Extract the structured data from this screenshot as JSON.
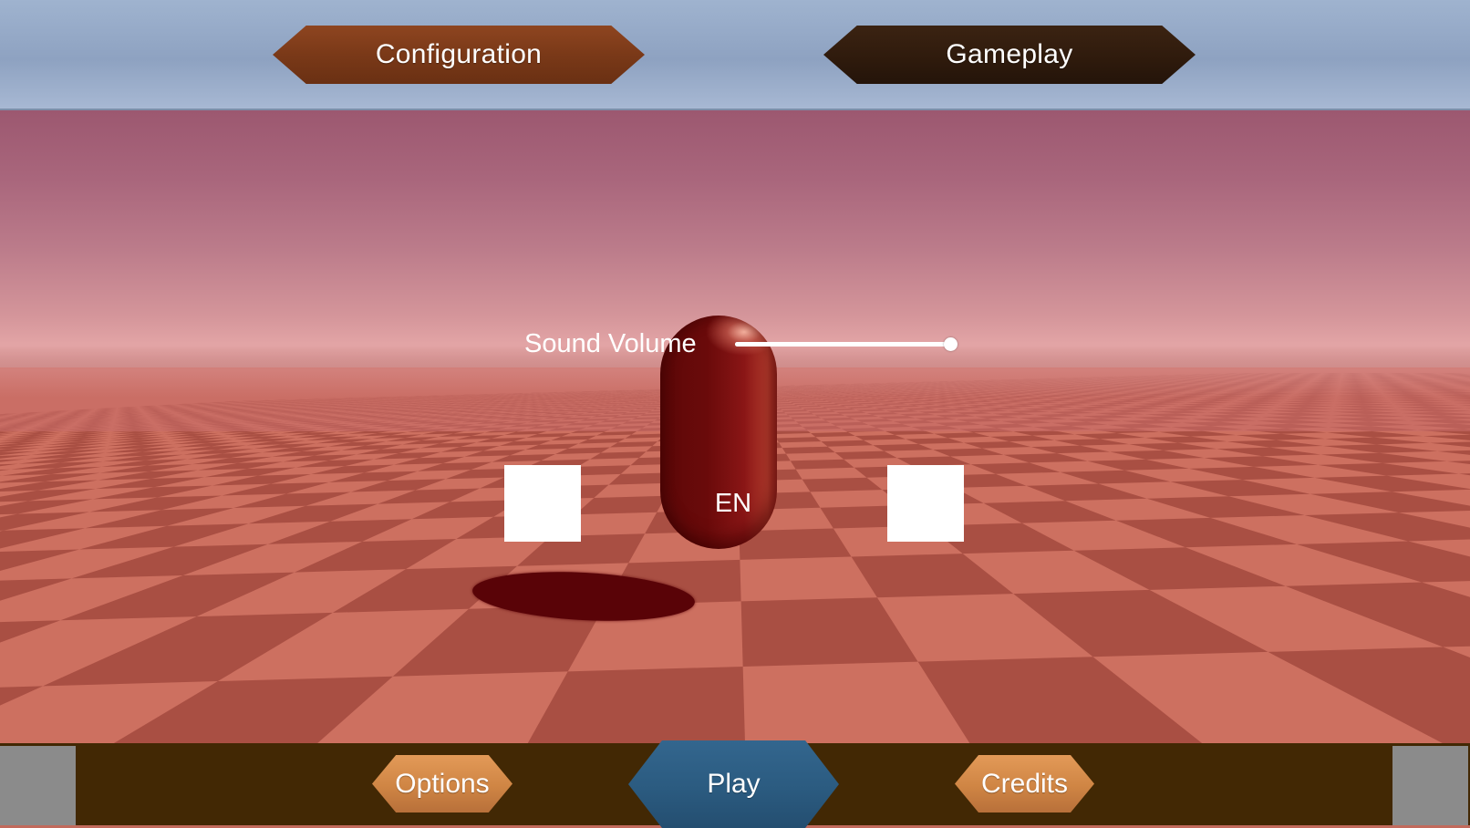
{
  "top_tabs": {
    "configuration": "Configuration",
    "gameplay": "Gameplay"
  },
  "settings": {
    "sound_volume_label": "Sound Volume",
    "sound_volume_value": 1.0,
    "language_label": "EN"
  },
  "bottom_nav": {
    "options": "Options",
    "play": "Play",
    "credits": "Credits"
  },
  "colors": {
    "top_bar": "#9fb3cf",
    "configuration_tab": "#7a3918",
    "gameplay_tab": "#2e1a0c",
    "bottom_bar": "#422804",
    "side_panels": "#8b8b8b",
    "options_credits_button": "#cf8544",
    "play_button": "#2b5b80",
    "floor_light": "#cd7060",
    "floor_dark": "#a94f43",
    "capsule": "#7a1010"
  }
}
